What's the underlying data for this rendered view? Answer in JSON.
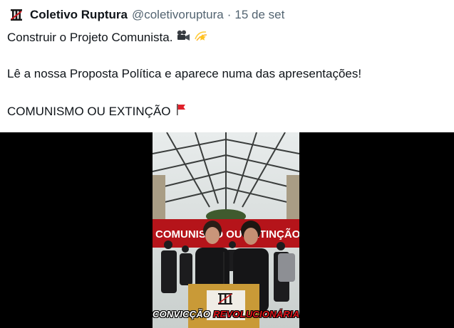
{
  "tweet": {
    "author_name": "Coletivo Ruptura",
    "handle": "@coletivoruptura",
    "separator": "·",
    "timestamp": "15 de set",
    "line1": "Construir o Projeto Comunista.",
    "line2": "Lê a nossa Proposta Política e aparece numa das apresentações!",
    "line3": "COMUNISMO OU EXTINÇÃO",
    "icons": [
      "avatar-logo-icon",
      "movie-camera-icon",
      "dizzy-star-icon",
      "red-flag-icon"
    ]
  },
  "video": {
    "banner_text": "COMUNISMO OU EXTINÇÃO",
    "caption_white": "CONVICÇÃO",
    "caption_red": "REVOLUCIONÁRIA",
    "accent_red": "#c8141b"
  }
}
